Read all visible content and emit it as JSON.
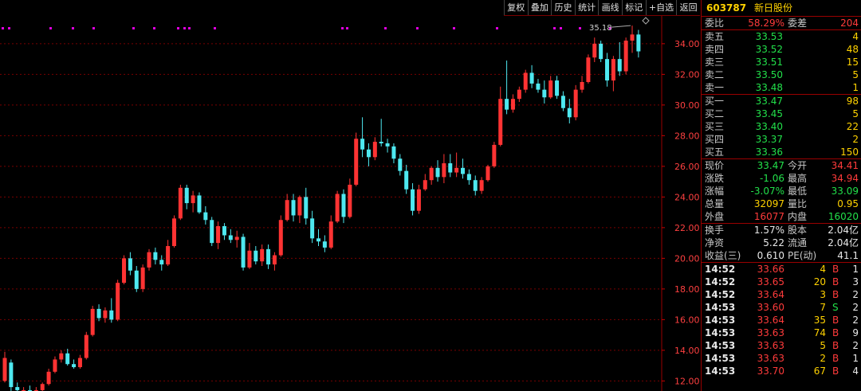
{
  "toolbar": [
    "复权",
    "叠加",
    "历史",
    "统计",
    "画线",
    "标记",
    "+自选",
    "返回"
  ],
  "stock": {
    "code": "603787",
    "name": "新日股份"
  },
  "order_ratio": {
    "label_ratio": "委比",
    "ratio": "58.29%",
    "label_diff": "委差",
    "diff": "204"
  },
  "asks": [
    {
      "label": "卖五",
      "price": "33.53",
      "vol": "4"
    },
    {
      "label": "卖四",
      "price": "33.52",
      "vol": "48"
    },
    {
      "label": "卖三",
      "price": "33.51",
      "vol": "15"
    },
    {
      "label": "卖二",
      "price": "33.50",
      "vol": "5"
    },
    {
      "label": "卖一",
      "price": "33.48",
      "vol": "1"
    }
  ],
  "bids": [
    {
      "label": "买一",
      "price": "33.47",
      "vol": "98"
    },
    {
      "label": "买二",
      "price": "33.45",
      "vol": "5"
    },
    {
      "label": "买三",
      "price": "33.40",
      "vol": "22"
    },
    {
      "label": "买四",
      "price": "33.37",
      "vol": "2"
    },
    {
      "label": "买五",
      "price": "33.36",
      "vol": "150"
    }
  ],
  "quote": [
    {
      "l1": "现价",
      "v1": "33.47",
      "c1": "grn",
      "l2": "今开",
      "v2": "34.41",
      "c2": "red"
    },
    {
      "l1": "涨跌",
      "v1": "-1.06",
      "c1": "grn",
      "l2": "最高",
      "v2": "34.94",
      "c2": "red"
    },
    {
      "l1": "涨幅",
      "v1": "-3.07%",
      "c1": "grn",
      "l2": "最低",
      "v2": "33.09",
      "c2": "grn"
    },
    {
      "l1": "总量",
      "v1": "32097",
      "c1": "yel",
      "l2": "量比",
      "v2": "0.95",
      "c2": "yel"
    },
    {
      "l1": "外盘",
      "v1": "16077",
      "c1": "red",
      "l2": "内盘",
      "v2": "16020",
      "c2": "grn"
    }
  ],
  "fundamentals": [
    {
      "l1": "换手",
      "v1": "1.57%",
      "l2": "股本",
      "v2": "2.04亿"
    },
    {
      "l1": "净资",
      "v1": "5.22",
      "l2": "流通",
      "v2": "2.04亿"
    },
    {
      "l1": "收益(三)",
      "v1": "0.610",
      "l2": "PE(动)",
      "v2": "41.1"
    }
  ],
  "ticks": [
    {
      "time": "14:52",
      "price": "33.66",
      "pc": "red",
      "vol": "4",
      "vc": "yel",
      "side": "B",
      "sc": "red",
      "cnt": "1"
    },
    {
      "time": "14:52",
      "price": "33.65",
      "pc": "red",
      "vol": "20",
      "vc": "yel",
      "side": "B",
      "sc": "red",
      "cnt": "3"
    },
    {
      "time": "14:52",
      "price": "33.64",
      "pc": "red",
      "vol": "3",
      "vc": "yel",
      "side": "B",
      "sc": "red",
      "cnt": "2"
    },
    {
      "time": "14:53",
      "price": "33.60",
      "pc": "red",
      "vol": "7",
      "vc": "yel",
      "side": "S",
      "sc": "grn",
      "cnt": "2"
    },
    {
      "time": "14:53",
      "price": "33.64",
      "pc": "red",
      "vol": "35",
      "vc": "yel",
      "side": "B",
      "sc": "red",
      "cnt": "2"
    },
    {
      "time": "14:53",
      "price": "33.63",
      "pc": "red",
      "vol": "74",
      "vc": "yel",
      "side": "B",
      "sc": "red",
      "cnt": "9"
    },
    {
      "time": "14:53",
      "price": "33.63",
      "pc": "red",
      "vol": "5",
      "vc": "yel",
      "side": "B",
      "sc": "red",
      "cnt": "2"
    },
    {
      "time": "14:53",
      "price": "33.63",
      "pc": "red",
      "vol": "2",
      "vc": "yel",
      "side": "B",
      "sc": "red",
      "cnt": "1"
    },
    {
      "time": "14:53",
      "price": "33.70",
      "pc": "red",
      "vol": "67",
      "vc": "yel",
      "side": "B",
      "sc": "red",
      "cnt": "4"
    }
  ],
  "chart_data": {
    "type": "candlestick",
    "ylim": [
      11.5,
      35.5
    ],
    "yticks": [
      "12.00",
      "14.00",
      "16.00",
      "18.00",
      "20.00",
      "22.00",
      "24.00",
      "26.00",
      "28.00",
      "30.00",
      "32.00",
      "34.00"
    ],
    "peak_label": "35.18",
    "colors": {
      "up": "#ff3333",
      "down": "#4ee8f0",
      "grid": "#7a0000",
      "axis_text": "#ff4040"
    },
    "ohlc": [
      [
        12.0,
        13.9,
        11.9,
        13.5
      ],
      [
        13.2,
        13.4,
        11.3,
        11.6
      ],
      [
        11.6,
        11.9,
        11.1,
        11.4
      ],
      [
        11.2,
        11.6,
        11.0,
        11.4
      ],
      [
        11.4,
        11.7,
        11.1,
        11.2
      ],
      [
        11.2,
        11.6,
        11.0,
        11.4
      ],
      [
        11.4,
        11.9,
        11.2,
        11.8
      ],
      [
        11.8,
        12.8,
        11.7,
        12.6
      ],
      [
        12.6,
        13.6,
        12.5,
        13.4
      ],
      [
        13.4,
        14.0,
        13.2,
        13.8
      ],
      [
        13.8,
        14.1,
        13.0,
        13.1
      ],
      [
        13.1,
        13.4,
        12.8,
        12.9
      ],
      [
        12.9,
        13.7,
        12.8,
        13.5
      ],
      [
        13.5,
        15.2,
        13.4,
        15.0
      ],
      [
        15.0,
        16.9,
        14.9,
        16.7
      ],
      [
        16.7,
        17.0,
        15.9,
        16.1
      ],
      [
        16.1,
        16.8,
        15.8,
        16.6
      ],
      [
        16.6,
        17.4,
        15.8,
        16.0
      ],
      [
        16.0,
        18.6,
        15.9,
        18.4
      ],
      [
        18.4,
        20.2,
        18.3,
        20.0
      ],
      [
        20.0,
        20.4,
        18.9,
        19.2
      ],
      [
        19.2,
        19.5,
        17.8,
        18.0
      ],
      [
        18.0,
        19.6,
        17.8,
        19.4
      ],
      [
        19.4,
        20.6,
        19.2,
        20.4
      ],
      [
        20.4,
        20.7,
        19.6,
        19.9
      ],
      [
        19.9,
        20.2,
        19.2,
        19.6
      ],
      [
        19.6,
        21.2,
        19.5,
        20.8
      ],
      [
        20.8,
        22.8,
        20.7,
        22.6
      ],
      [
        22.6,
        24.8,
        22.5,
        24.6
      ],
      [
        24.6,
        24.8,
        23.2,
        23.6
      ],
      [
        23.6,
        24.4,
        23.0,
        24.1
      ],
      [
        24.1,
        24.3,
        22.9,
        23.0
      ],
      [
        23.0,
        23.4,
        22.2,
        22.5
      ],
      [
        22.5,
        22.7,
        20.8,
        21.0
      ],
      [
        21.0,
        22.4,
        20.6,
        22.1
      ],
      [
        22.1,
        22.3,
        21.2,
        21.5
      ],
      [
        21.5,
        21.9,
        21.0,
        21.2
      ],
      [
        21.2,
        21.8,
        20.7,
        21.4
      ],
      [
        21.4,
        21.6,
        19.2,
        19.4
      ],
      [
        19.4,
        21.0,
        19.3,
        20.5
      ],
      [
        20.5,
        20.8,
        19.6,
        19.8
      ],
      [
        19.8,
        20.9,
        19.5,
        20.6
      ],
      [
        20.6,
        20.9,
        19.3,
        19.6
      ],
      [
        19.6,
        20.4,
        19.2,
        20.2
      ],
      [
        20.2,
        22.8,
        20.1,
        22.5
      ],
      [
        22.5,
        24.2,
        22.4,
        23.8
      ],
      [
        23.8,
        24.2,
        22.4,
        22.8
      ],
      [
        22.8,
        24.1,
        22.3,
        24.0
      ],
      [
        24.0,
        24.6,
        22.2,
        22.6
      ],
      [
        22.6,
        23.1,
        21.0,
        21.3
      ],
      [
        21.3,
        21.9,
        20.8,
        21.1
      ],
      [
        21.1,
        21.5,
        20.4,
        20.7
      ],
      [
        20.7,
        22.8,
        20.6,
        22.4
      ],
      [
        22.4,
        24.4,
        22.3,
        24.2
      ],
      [
        24.2,
        24.5,
        22.3,
        22.7
      ],
      [
        22.7,
        25.2,
        22.6,
        24.8
      ],
      [
        24.8,
        28.2,
        24.7,
        27.8
      ],
      [
        27.8,
        29.2,
        26.6,
        27.1
      ],
      [
        27.1,
        27.5,
        26.0,
        26.6
      ],
      [
        26.6,
        27.9,
        26.4,
        27.6
      ],
      [
        27.6,
        29.1,
        27.3,
        27.5
      ],
      [
        27.5,
        27.8,
        26.9,
        27.3
      ],
      [
        27.3,
        27.5,
        26.2,
        26.5
      ],
      [
        26.5,
        26.8,
        25.4,
        25.7
      ],
      [
        25.7,
        26.1,
        24.2,
        24.5
      ],
      [
        24.5,
        24.9,
        22.8,
        23.1
      ],
      [
        23.1,
        24.8,
        22.9,
        24.5
      ],
      [
        24.5,
        25.5,
        24.4,
        25.1
      ],
      [
        25.1,
        26.0,
        24.8,
        25.9
      ],
      [
        25.9,
        26.4,
        25.0,
        25.3
      ],
      [
        25.3,
        26.8,
        24.9,
        26.2
      ],
      [
        26.2,
        26.8,
        25.3,
        25.6
      ],
      [
        25.6,
        26.9,
        25.3,
        25.9
      ],
      [
        25.9,
        26.5,
        25.2,
        25.5
      ],
      [
        25.5,
        25.8,
        24.8,
        25.1
      ],
      [
        25.1,
        25.4,
        24.1,
        24.4
      ],
      [
        24.4,
        25.3,
        24.2,
        25.1
      ],
      [
        25.1,
        26.1,
        25.0,
        26.0
      ],
      [
        26.0,
        27.6,
        25.9,
        27.4
      ],
      [
        27.4,
        31.2,
        27.3,
        30.4
      ],
      [
        30.4,
        32.9,
        29.4,
        29.7
      ],
      [
        29.7,
        30.7,
        29.5,
        30.4
      ],
      [
        30.4,
        31.2,
        30.2,
        31.0
      ],
      [
        31.0,
        32.3,
        30.8,
        32.1
      ],
      [
        32.1,
        32.6,
        31.1,
        31.4
      ],
      [
        31.4,
        31.7,
        30.8,
        31.0
      ],
      [
        31.0,
        31.6,
        30.1,
        30.5
      ],
      [
        30.5,
        31.9,
        30.4,
        31.6
      ],
      [
        31.6,
        31.9,
        30.4,
        30.6
      ],
      [
        30.6,
        30.9,
        29.6,
        29.8
      ],
      [
        29.8,
        30.4,
        28.8,
        29.2
      ],
      [
        29.2,
        31.3,
        29.0,
        31.0
      ],
      [
        31.0,
        31.9,
        30.8,
        31.5
      ],
      [
        31.5,
        33.3,
        31.4,
        33.1
      ],
      [
        33.1,
        34.4,
        32.8,
        34.0
      ],
      [
        34.0,
        34.2,
        32.8,
        33.0
      ],
      [
        33.0,
        33.4,
        31.2,
        31.6
      ],
      [
        31.6,
        33.2,
        30.9,
        33.0
      ],
      [
        33.0,
        34.1,
        31.9,
        32.2
      ],
      [
        32.2,
        34.4,
        32.0,
        34.2
      ],
      [
        34.2,
        35.18,
        33.4,
        34.6
      ],
      [
        34.6,
        34.9,
        33.1,
        33.5
      ]
    ]
  }
}
